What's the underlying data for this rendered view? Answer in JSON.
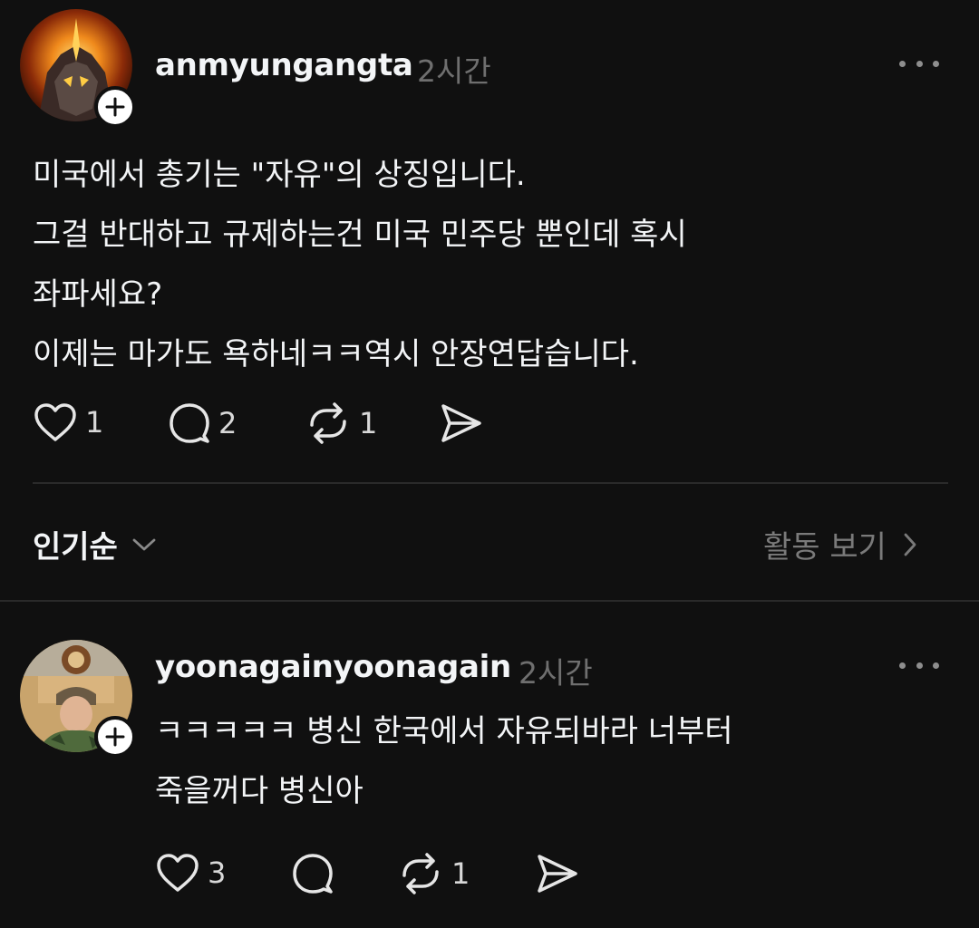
{
  "post": {
    "username": "anmyungangta",
    "time": "2시간",
    "lines": [
      "미국에서 총기는 \"자유\"의 상징입니다.",
      "그걸 반대하고 규제하는건 미국 민주당 뿐인데 혹시",
      "좌파세요?",
      "이제는 마가도 욕하네ㅋㅋ역시 안장연답습니다."
    ],
    "likes": "1",
    "comments": "2",
    "reposts": "1"
  },
  "sort_bar": {
    "sort_label": "인기순",
    "activity_label": "활동 보기"
  },
  "reply": {
    "username": "yoonagainyoonagain",
    "time": "2시간",
    "lines": [
      "ㅋㅋㅋㅋㅋ 병신 한국에서 자유되바라 너부터",
      "죽을꺼다 병신아"
    ],
    "likes": "3",
    "reposts": "1"
  },
  "icons": {
    "like": "heart-icon",
    "comment": "comment-bubble-icon",
    "repost": "repost-icon",
    "share": "send-icon",
    "more": "more-dots-icon",
    "follow": "plus-icon",
    "sort": "chevron-down-icon",
    "activity": "chevron-right-icon"
  }
}
